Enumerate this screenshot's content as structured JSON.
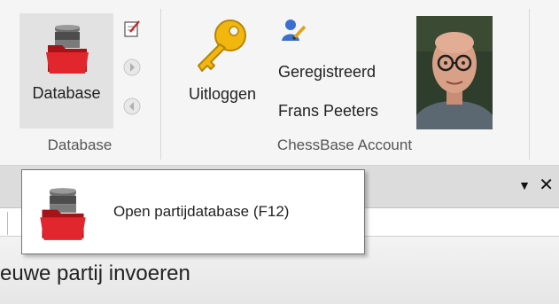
{
  "ribbon": {
    "database_group": {
      "label": "Database",
      "main_button": {
        "label": "Database",
        "icon": "database-folder-icon"
      },
      "small_buttons": [
        "edit-icon",
        "forward-icon",
        "back-icon"
      ]
    },
    "account_group": {
      "label": "ChessBase Account",
      "logout_button": {
        "label": "Uitloggen",
        "icon": "key-icon"
      },
      "status": "Geregistreerd",
      "user_name": "Frans Peeters",
      "user_icon": "user-edit-icon"
    }
  },
  "pane": {
    "dropdown_icon": "triangle-down-icon",
    "close_icon": "close-icon"
  },
  "tab_text": "euwe partij invoeren",
  "tooltip": {
    "text": "Open partijdatabase (F12)",
    "icon": "database-folder-icon"
  },
  "colors": {
    "folder_red": "#d21f26",
    "key_gold": "#f2b70f",
    "ribbon_bg": "#f5f5f5"
  }
}
